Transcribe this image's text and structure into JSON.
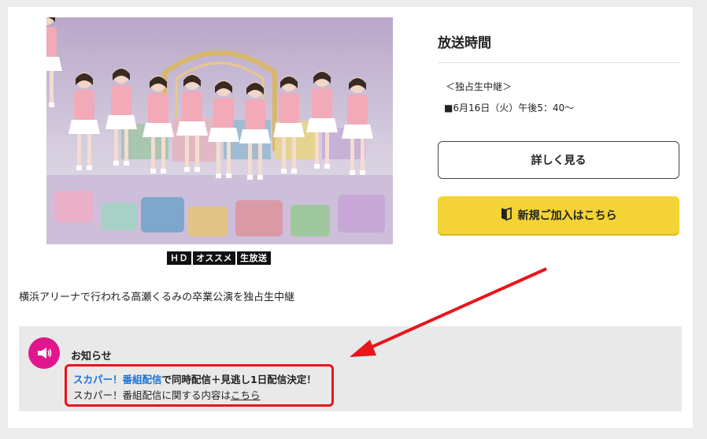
{
  "program": {
    "badges": [
      "ＨＤ",
      "オススメ",
      "生放送"
    ],
    "description": "横浜アリーナで行われる高瀬くるみの卒業公演を独占生中継"
  },
  "broadcast": {
    "title": "放送時間",
    "note": "＜独占生中継＞",
    "datetime": "■6月16日（火）午後5：40～",
    "detail_button": "詳しく見る",
    "join_button": "新規ご加入はこちら"
  },
  "notice": {
    "title": "お知らせ",
    "line1_highlight": "スカパー！番組配信",
    "line1_rest": "で同時配信＋見逃し1日配信決定！",
    "line2_text": "スカパー！番組配信に関する内容は",
    "line2_link": "こちら"
  },
  "colors": {
    "accent_yellow": "#f3d335",
    "notice_pink": "#e0178c",
    "highlight_blue": "#1a73d9",
    "annotation_red": "#e8151b"
  },
  "icons": {
    "join": "book-icon",
    "notice": "megaphone-icon"
  }
}
